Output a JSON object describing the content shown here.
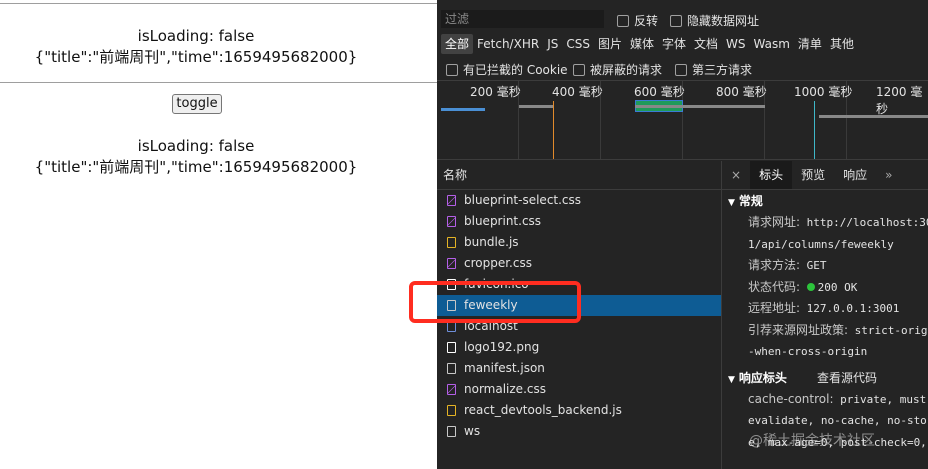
{
  "app": {
    "top_state": {
      "loading_line": "isLoading: false",
      "data_line": "{\"title\":\"前端周刊\",\"time\":1659495682000}"
    },
    "toggle_label": "toggle",
    "bottom_state": {
      "loading_line": "isLoading: false",
      "data_line": "{\"title\":\"前端周刊\",\"time\":1659495682000}"
    }
  },
  "devtools": {
    "filter_placeholder": "过滤",
    "invert_label": "反转",
    "hide_data_urls_label": "隐藏数据网址",
    "types": [
      "全部",
      "Fetch/XHR",
      "JS",
      "CSS",
      "图片",
      "媒体",
      "字体",
      "文档",
      "WS",
      "Wasm",
      "清单",
      "其他"
    ],
    "blocked_cookies_label": "有已拦截的 Cookie",
    "blocked_requests_label": "被屏蔽的请求",
    "third_party_label": "第三方请求",
    "timeline_ticks": [
      "200 毫秒",
      "400 毫秒",
      "600 毫秒",
      "800 毫秒",
      "1000 毫秒",
      "1200 毫秒"
    ],
    "name_header": "名称",
    "requests": [
      {
        "name": "blueprint-select.css",
        "type": "css"
      },
      {
        "name": "blueprint.css",
        "type": "css"
      },
      {
        "name": "bundle.js",
        "type": "js"
      },
      {
        "name": "cropper.css",
        "type": "css"
      },
      {
        "name": "favicon.ico",
        "type": "img"
      },
      {
        "name": "feweekly",
        "type": "plain",
        "selected": true
      },
      {
        "name": "localhost",
        "type": "doc"
      },
      {
        "name": "logo192.png",
        "type": "img"
      },
      {
        "name": "manifest.json",
        "type": "plain"
      },
      {
        "name": "normalize.css",
        "type": "css"
      },
      {
        "name": "react_devtools_backend.js",
        "type": "js"
      },
      {
        "name": "ws",
        "type": "plain"
      }
    ],
    "detail_tabs": {
      "close": "×",
      "headers": "标头",
      "preview": "预览",
      "response": "响应",
      "more": "»"
    },
    "general": {
      "title": "常规",
      "request_url_label": "请求网址:",
      "request_url_value": "http://localhost:30",
      "request_url_value_cont": "1/api/columns/feweekly",
      "method_label": "请求方法:",
      "method_value": "GET",
      "status_label": "状态代码:",
      "status_value": "200 OK",
      "remote_label": "远程地址:",
      "remote_value": "127.0.0.1:3001",
      "referrer_label": "引荐来源网址政策:",
      "referrer_value": "strict-origi",
      "referrer_value_cont": "-when-cross-origin"
    },
    "response_headers": {
      "title": "响应标头",
      "view_source": "查看源代码",
      "cache_label": "cache-control:",
      "cache_value": "private, must-",
      "cache_cont1": "evalidate, no-cache, no-sto",
      "cache_cont2": "e, max-age=0, post-check=0,"
    },
    "watermark": "@稀土掘金技术社区",
    "colors": {
      "selected_row": "#0e5c94",
      "highlight": "#ff2d20",
      "status_dot": "#2cc43b"
    }
  }
}
